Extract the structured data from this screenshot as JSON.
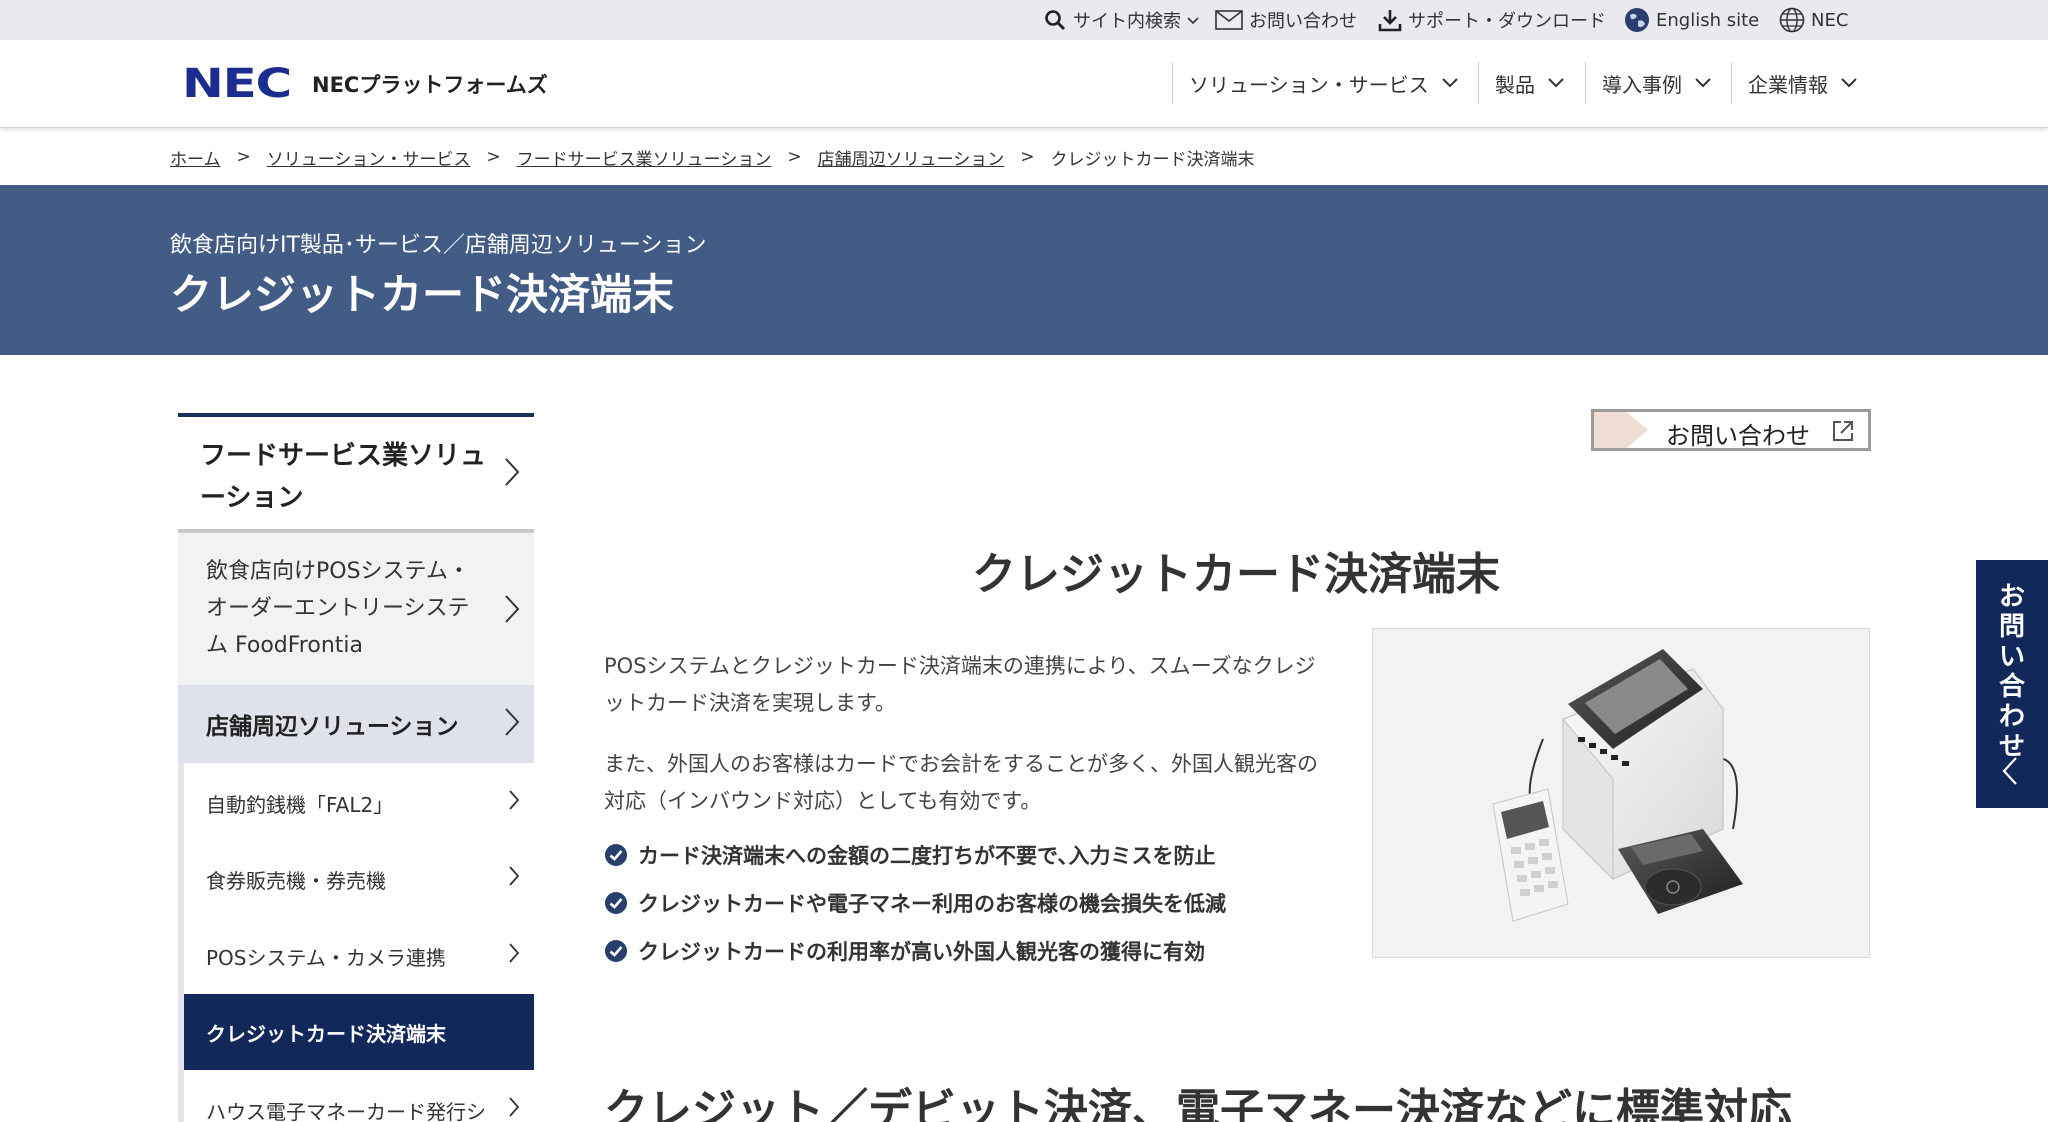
{
  "utility": {
    "search": "サイト内検索",
    "contact": "お問い合わせ",
    "support": "サポート・ダウンロード",
    "english": "English site",
    "nec": "NEC"
  },
  "header": {
    "logo": "NEC",
    "company": "NECプラットフォームズ",
    "nav": [
      "ソリューション・サービス",
      "製品",
      "導入事例",
      "企業情報"
    ]
  },
  "breadcrumb": [
    "ホーム",
    "ソリューション・サービス",
    "フードサービス業ソリューション",
    "店舗周辺ソリューション",
    "クレジットカード決済端末"
  ],
  "breadcrumb_sep": ">",
  "hero": {
    "subtitle": "飲食店向けIT製品･サービス／店舗周辺ソリューション",
    "title": "クレジットカード決済端末"
  },
  "sidebar": {
    "heading_lines": [
      "フードサービス業ソリュ",
      "ーション"
    ],
    "pos_lines": [
      "飲食店向けPOSシステム・",
      "オーダーエントリーシステ",
      "ム FoodFrontia"
    ],
    "section": "店舗周辺ソリューション",
    "items": [
      "自動釣銭機「FAL2」",
      "食券販売機・券売機",
      "POSシステム・カメラ連携",
      "クレジットカード決済端末",
      "ハウス電子マネーカード発行シ"
    ]
  },
  "main": {
    "contact_button": "お問い合わせ",
    "title": "クレジットカード決済端末",
    "para1": "POSシステムとクレジットカード決済端末の連携により、スムーズなクレジットカード決済を実現します。",
    "para2": "また、外国人のお客様はカードでお会計をすることが多く、外国人観光客の対応（インバウンド対応）としても有効です。",
    "checks": [
      "カード決済端末への金額の二度打ちが不要で､入力ミスを防止",
      "クレジットカードや電子マネー利用のお客様の機会損失を低減",
      "クレジットカードの利用率が高い外国人観光客の獲得に有効"
    ],
    "section_title": "クレジット／デビット決済、電子マネー決済などに標準対応"
  },
  "float_tab": "お問い合わせ",
  "colors": {
    "hero": "#435c86",
    "navy": "#13285a",
    "logo": "#1c2d8f",
    "active_section": "#dfe2ea"
  }
}
